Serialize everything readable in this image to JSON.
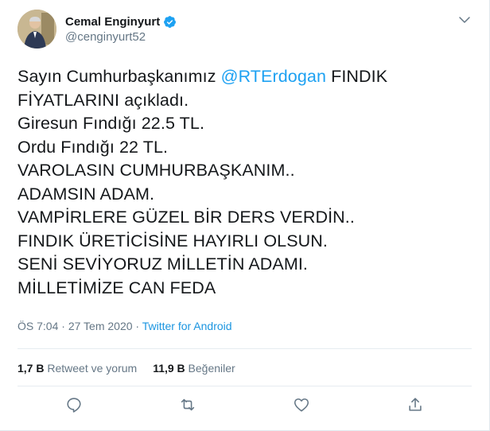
{
  "user": {
    "display_name": "Cemal Enginyurt",
    "handle": "@cenginyurt52",
    "verified": true
  },
  "tweet": {
    "line1_pre": "Sayın Cumhurbaşkanımız ",
    "line1_mention": "@RTErdogan",
    "line1_post": " FINDIK",
    "lines": [
      "FİYATLARINI açıkladı.",
      "Giresun Fındığı 22.5 TL.",
      "Ordu Fındığı 22 TL.",
      "VAROLASIN CUMHURBAŞKANIM..",
      "ADAMSIN ADAM.",
      "VAMPİRLERE GÜZEL BİR DERS VERDİN..",
      "FINDIK ÜRETİCİSİNE HAYIRLI OLSUN.",
      "SENİ SEVİYORUZ MİLLETİN ADAMI.",
      "MİLLETİMİZE CAN FEDA"
    ]
  },
  "meta": {
    "time": "ÖS 7:04",
    "separator": " · ",
    "date": "27 Tem 2020",
    "separator2": " · ",
    "source": "Twitter for Android"
  },
  "stats": {
    "retweets_count": "1,7 B",
    "retweets_label": " Retweet ve yorum",
    "likes_count": "11,9 B",
    "likes_label": " Beğeniler"
  },
  "icons": {
    "verified": "verified-badge-icon",
    "menu": "chevron-down-icon",
    "reply": "reply-icon",
    "retweet": "retweet-icon",
    "like": "heart-icon",
    "share": "share-icon"
  },
  "colors": {
    "accent": "#1da1f2",
    "text": "#14171a",
    "muted": "#657786"
  }
}
